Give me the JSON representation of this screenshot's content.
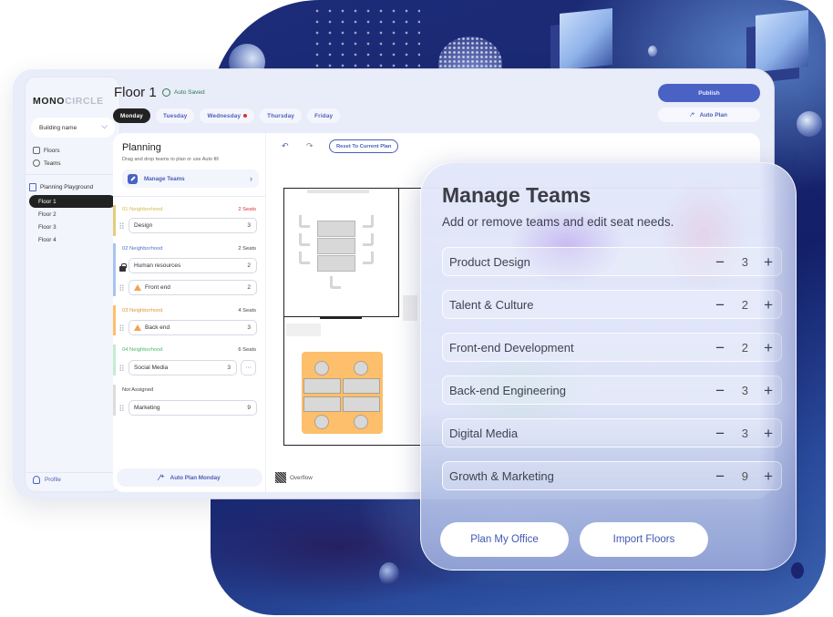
{
  "app": {
    "logo": {
      "bold": "MONO",
      "light": "CIRCLE"
    },
    "building_select": {
      "value": "Building name"
    },
    "nav": [
      {
        "label": "Floors",
        "icon": "floors-icon"
      },
      {
        "label": "Teams",
        "icon": "teams-icon"
      }
    ],
    "planning_playground": {
      "label": "Planning Playground",
      "icon": "layout-icon"
    },
    "floors": [
      {
        "label": "Floor 1",
        "active": true
      },
      {
        "label": "Floor 2",
        "active": false
      },
      {
        "label": "Floor 3",
        "active": false
      },
      {
        "label": "Floor 4",
        "active": false
      }
    ],
    "profile": {
      "label": "Profile"
    },
    "header": {
      "title": "Floor 1",
      "status": "Auto Saved",
      "publish_label": "Publish",
      "auto_plan_label": "Auto Plan"
    },
    "days": [
      {
        "label": "Monday",
        "active": true,
        "alert": false
      },
      {
        "label": "Tuesday",
        "active": false,
        "alert": false
      },
      {
        "label": "Wednesday",
        "active": false,
        "alert": true
      },
      {
        "label": "Thursday",
        "active": false,
        "alert": false
      },
      {
        "label": "Friday",
        "active": false,
        "alert": false
      }
    ],
    "planning": {
      "title": "Planning",
      "subtitle": "Drag and drop teams to plan or use Auto fill",
      "manage_teams_label": "Manage Teams",
      "neighborhoods": [
        {
          "label": "01 Neighborhood",
          "seats": "2 Seats",
          "color": "#d9b64a",
          "seats_color": "#d8312f",
          "teams": [
            {
              "name": "Design",
              "count": "3",
              "locked": false,
              "warning": false
            }
          ]
        },
        {
          "label": "02 Neighborhood",
          "seats": "2 Seats",
          "color": "#4a74c9",
          "seats_color": "#444444",
          "teams": [
            {
              "name": "Human resources",
              "count": "2",
              "locked": true,
              "warning": false
            },
            {
              "name": "Front end",
              "count": "2",
              "locked": false,
              "warning": true
            }
          ]
        },
        {
          "label": "03 Neighborhood",
          "seats": "4 Seats",
          "color": "#e0963a",
          "seats_color": "#444444",
          "teams": [
            {
              "name": "Back end",
              "count": "3",
              "locked": false,
              "warning": true
            }
          ]
        },
        {
          "label": "04 Neighborhood",
          "seats": "6 Seats",
          "color": "#4fb56a",
          "seats_color": "#444444",
          "teams": [
            {
              "name": "Social Media",
              "count": "3",
              "locked": false,
              "warning": false,
              "more": "···"
            }
          ]
        },
        {
          "label": "Not Assigned",
          "seats": "",
          "color": "#444444",
          "seats_color": "#444444",
          "teams": [
            {
              "name": "Marketing",
              "count": "9",
              "locked": false,
              "warning": false
            }
          ]
        }
      ],
      "auto_plan_day_label": "Auto Plan Monday"
    },
    "canvas": {
      "undo_icon": "↶",
      "redo_icon": "↷",
      "reset_label": "Reset To Current Plan",
      "legend_overflow": "Overflow"
    }
  },
  "manage_teams_card": {
    "title": "Manage Teams",
    "subtitle": "Add or remove teams and edit seat needs.",
    "teams": [
      {
        "name": "Product Design",
        "seats": "3"
      },
      {
        "name": "Talent & Culture",
        "seats": "2"
      },
      {
        "name": "Front-end Development",
        "seats": "2"
      },
      {
        "name": "Back-end Engineering",
        "seats": "3"
      },
      {
        "name": "Digital Media",
        "seats": "3"
      },
      {
        "name": "Growth & Marketing",
        "seats": "9"
      }
    ],
    "minus_glyph": "−",
    "plus_glyph": "+",
    "primary_button": "Plan My Office",
    "secondary_button": "Import Floors"
  },
  "colors": {
    "accent": "#4a62c4",
    "active_dark": "#222222",
    "alert": "#d8312f",
    "desk_pod": "#fdbf6b"
  }
}
